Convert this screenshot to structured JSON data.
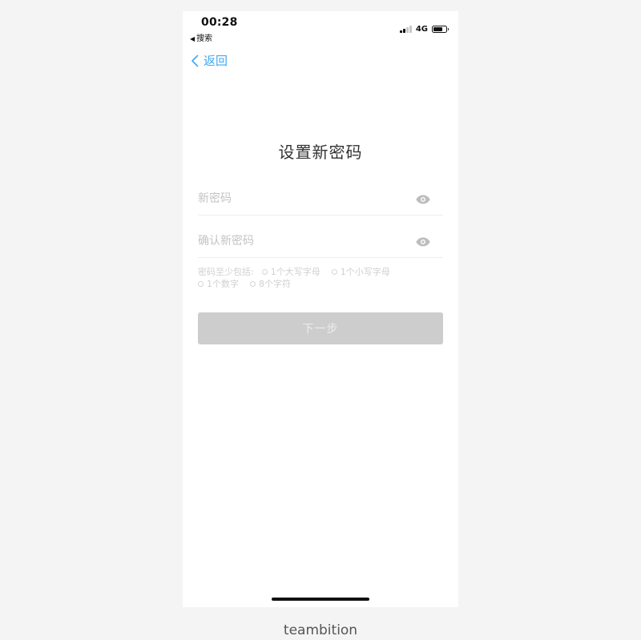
{
  "status_bar": {
    "time": "00:28",
    "back_app": "搜索",
    "network": "4G"
  },
  "nav": {
    "back_label": "返回"
  },
  "page": {
    "title": "设置新密码"
  },
  "form": {
    "new_password": {
      "value": "",
      "placeholder": "新密码"
    },
    "confirm_password": {
      "value": "",
      "placeholder": "确认新密码"
    }
  },
  "requirements": {
    "lead": "密码至少包括:",
    "items": [
      "1个大写字母",
      "1个小写字母",
      "1个数字",
      "8个字符"
    ]
  },
  "actions": {
    "next_label": "下一步"
  },
  "footer": {
    "brand": "teambition"
  },
  "colors": {
    "accent": "#3da8f5",
    "button_disabled": "#cdcdcd",
    "placeholder": "#c4c4c4"
  },
  "icons": {
    "back": "chevron-left-icon",
    "visibility": "eye-icon",
    "requirement": "circle-outline-icon"
  }
}
